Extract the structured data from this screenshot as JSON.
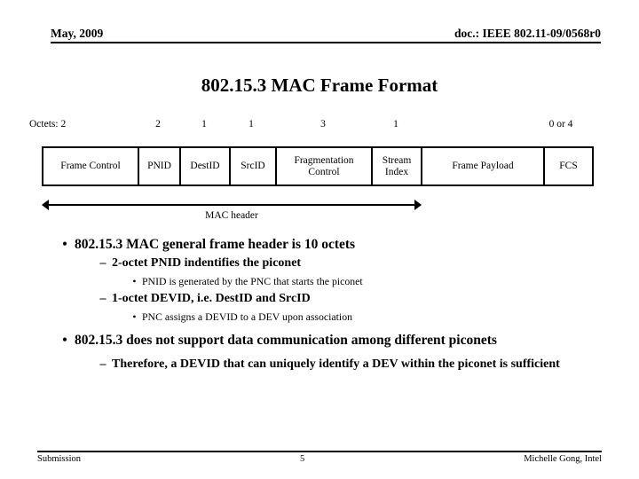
{
  "header": {
    "date": "May, 2009",
    "doc_id": "doc.: IEEE 802.11-09/0568r0"
  },
  "title": "802.15.3 MAC Frame Format",
  "frame_diagram": {
    "octets_prefix": "Octets: 2",
    "octet_labels": [
      "2",
      "1",
      "1",
      "3",
      "1",
      "0 or 4"
    ],
    "fields": [
      {
        "label": "Frame Control",
        "octets": "2"
      },
      {
        "label": "PNID",
        "octets": "2"
      },
      {
        "label": "DestID",
        "octets": "1"
      },
      {
        "label": "SrcID",
        "octets": "1"
      },
      {
        "label": "Fragmentation Control",
        "octets": "3"
      },
      {
        "label": "Stream Index",
        "octets": "1"
      },
      {
        "label": "Frame Payload",
        "octets": ""
      },
      {
        "label": "FCS",
        "octets": "0 or 4"
      }
    ],
    "span_label": "MAC header"
  },
  "bullets": {
    "b1": "802.15.3 MAC general frame header is 10 octets",
    "b1s1": "2-octet PNID indentifies the piconet",
    "b1s1a": "PNID is generated by the PNC that starts the piconet",
    "b1s2": "1-octet DEVID, i.e. DestID and SrcID",
    "b1s2a": "PNC assigns a DEVID to a DEV upon association",
    "b2": "802.15.3 does not support data communication among different piconets",
    "b2s1": "Therefore, a DEVID that can uniquely identify a DEV within the piconet is sufficient"
  },
  "markers": {
    "disc": "•",
    "dash": "–",
    "small_disc": "•"
  },
  "footer": {
    "left": "Submission",
    "page": "5",
    "right": "Michelle Gong, Intel"
  }
}
